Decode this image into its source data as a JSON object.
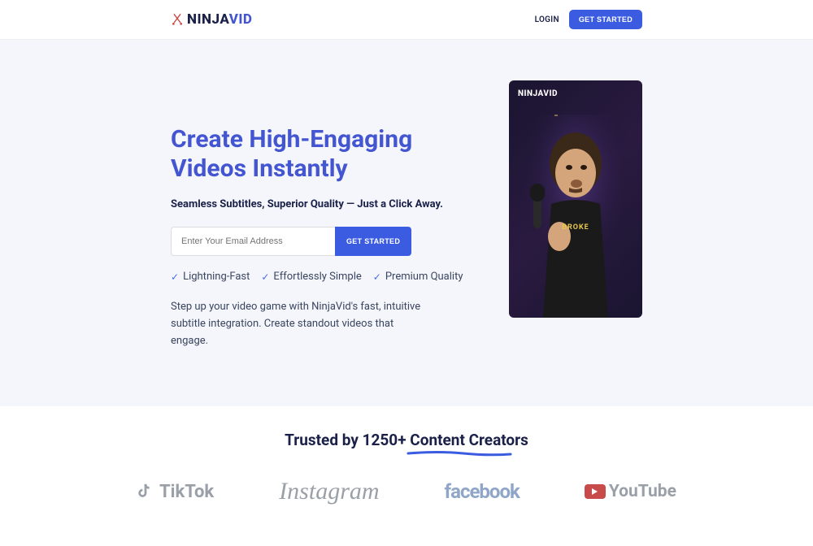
{
  "logo": {
    "ninja": "NINJA",
    "vid": "VID"
  },
  "header": {
    "login": "LOGIN",
    "cta": "GET STARTED"
  },
  "hero": {
    "title": "Create High-Engaging Videos Instantly",
    "subtitle": "Seamless Subtitles, Superior Quality — Just a Click Away.",
    "email_placeholder": "Enter Your Email Address",
    "email_cta": "GET STARTED",
    "features": [
      "Lightning-Fast",
      "Effortlessly Simple",
      "Premium Quality"
    ],
    "desc": "Step up your video game with NinjaVid's fast, intuitive subtitle integration. Create standout videos that engage.",
    "video_logo": "NINJAVID",
    "caption": "BROKE"
  },
  "trusted": {
    "title_prefix": "Trusted by 1250+ ",
    "title_highlight": "Content Creators",
    "socials": {
      "tiktok": "TikTok",
      "instagram": "Instagram",
      "facebook": "facebook",
      "youtube": "YouTube"
    }
  }
}
